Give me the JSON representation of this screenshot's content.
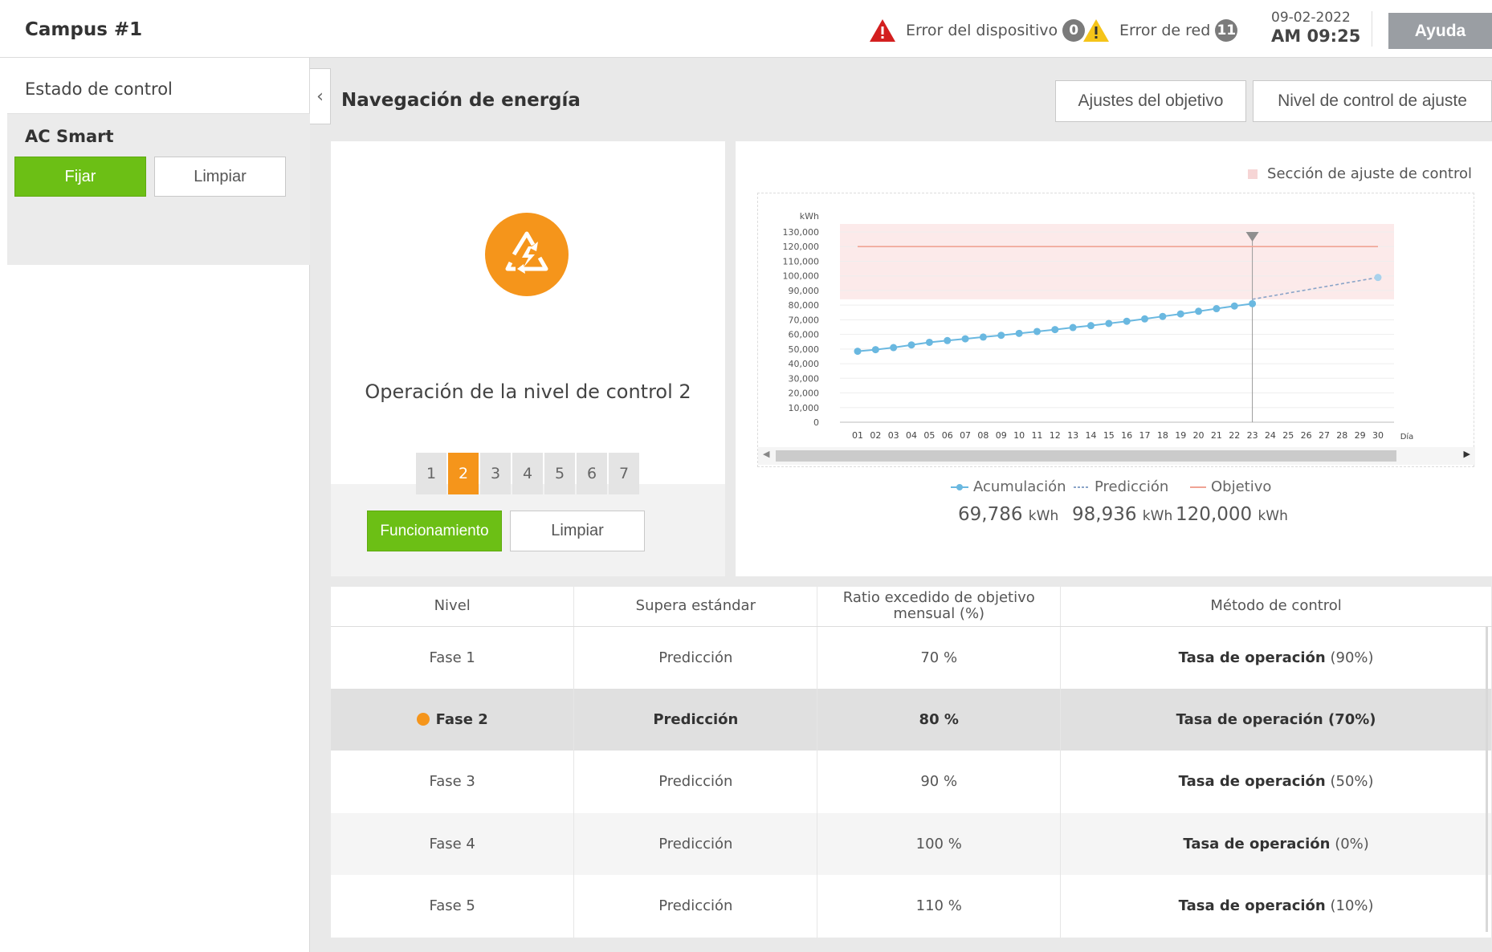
{
  "header": {
    "campus": "Campus #1",
    "device_error": {
      "label": "Error del dispositivo",
      "count": "0"
    },
    "network_error": {
      "label": "Error de red",
      "count": "11"
    },
    "date": "09-02-2022",
    "time": "AM 09:25",
    "help": "Ayuda"
  },
  "sidebar": {
    "title": "Estado de control",
    "device": "AC Smart",
    "set_label": "Fijar",
    "clear_label": "Limpiar"
  },
  "main": {
    "title": "Navegación de energía",
    "btn_target": "Ajustes del objetivo",
    "btn_level": "Nivel de control de ajuste"
  },
  "control": {
    "operation_title": "Operación de la nivel de control 2",
    "levels": [
      "1",
      "2",
      "3",
      "4",
      "5",
      "6",
      "7"
    ],
    "active_level": "2",
    "run_label": "Funcionamiento",
    "clear_label": "Limpiar"
  },
  "chart_data": {
    "type": "line",
    "section_legend": "Sección de ajuste de control",
    "ylabel": "kWh",
    "xlabel": "Día",
    "ylim": [
      0,
      130000
    ],
    "y_ticks": [
      "130,000",
      "120,000",
      "110,000",
      "100,000",
      "90,000",
      "80,000",
      "70,000",
      "60,000",
      "50,000",
      "40,000",
      "30,000",
      "20,000",
      "10,000",
      "0"
    ],
    "x": [
      "01",
      "02",
      "03",
      "04",
      "05",
      "06",
      "07",
      "08",
      "09",
      "10",
      "11",
      "12",
      "13",
      "14",
      "15",
      "16",
      "17",
      "18",
      "19",
      "20",
      "21",
      "22",
      "23",
      "24",
      "25",
      "26",
      "27",
      "28",
      "29",
      "30"
    ],
    "control_band": [
      84000,
      130000
    ],
    "today_marker": "23",
    "series": [
      {
        "name": "Acumulación",
        "style": "solid-dots",
        "color": "#6ab8e0",
        "x": [
          "01",
          "02",
          "03",
          "04",
          "05",
          "06",
          "07",
          "08",
          "09",
          "10",
          "11",
          "12",
          "13",
          "14",
          "15",
          "16",
          "17",
          "18",
          "19",
          "20",
          "21",
          "22",
          "23"
        ],
        "values": [
          48500,
          49600,
          51000,
          52800,
          54600,
          55800,
          57000,
          58200,
          59400,
          60700,
          62000,
          63300,
          64700,
          66000,
          67500,
          69000,
          70600,
          72300,
          74000,
          75800,
          77600,
          79400,
          81000
        ]
      },
      {
        "name": "Predicción",
        "style": "dashed",
        "color": "#8aa4c8",
        "x": [
          "23",
          "30"
        ],
        "values": [
          84000,
          98936
        ]
      },
      {
        "name": "Objetivo",
        "style": "solid",
        "color": "#f0a394",
        "x": [
          "01",
          "30"
        ],
        "values": [
          120000,
          120000
        ]
      }
    ],
    "totals": [
      {
        "name": "Acumulación",
        "value": "69,786",
        "unit": "kWh"
      },
      {
        "name": "Predicción",
        "value": "98,936",
        "unit": "kWh"
      },
      {
        "name": "Objetivo",
        "value": "120,000",
        "unit": "kWh"
      }
    ]
  },
  "table": {
    "headers": [
      "Nivel",
      "Supera estándar",
      "Ratio excedido de objetivo mensual (%)",
      "Método de control"
    ],
    "rows": [
      {
        "level": "Fase 1",
        "std": "Predicción",
        "ratio": "70 %",
        "method": "Tasa de operación",
        "pct": "(90%)"
      },
      {
        "level": "Fase 2",
        "std": "Predicción",
        "ratio": "80 %",
        "method": "Tasa de operación",
        "pct": "(70%)"
      },
      {
        "level": "Fase 3",
        "std": "Predicción",
        "ratio": "90 %",
        "method": "Tasa de operación",
        "pct": "(50%)"
      },
      {
        "level": "Fase 4",
        "std": "Predicción",
        "ratio": "100 %",
        "method": "Tasa de operación",
        "pct": "(0%)"
      },
      {
        "level": "Fase 5",
        "std": "Predicción",
        "ratio": "110 %",
        "method": "Tasa de operación",
        "pct": "(10%)"
      }
    ],
    "selected_row": "Fase 2"
  },
  "colors": {
    "accent_green": "#6cbf15",
    "accent_orange": "#f5951b",
    "error_red": "#d31f1f",
    "warning_yellow": "#f5c419"
  }
}
